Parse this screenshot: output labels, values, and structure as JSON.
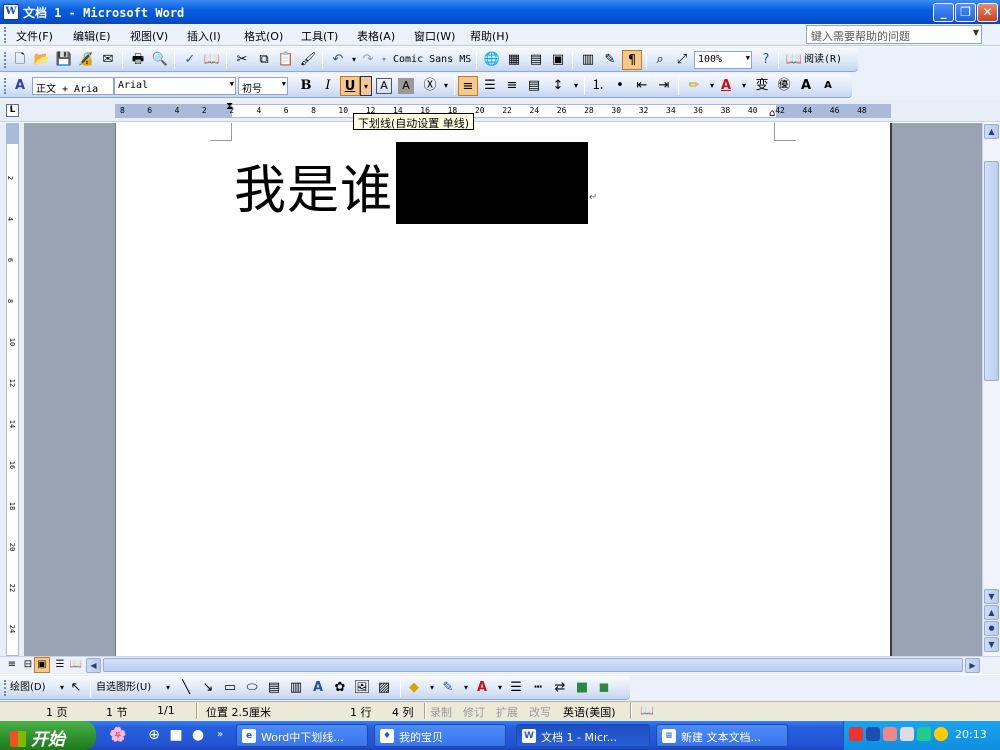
{
  "titlebar": {
    "title": "文档 1 - Microsoft Word",
    "app_icon": "W",
    "minimize_icon": "minimize-icon",
    "maximize_icon": "restore-icon",
    "close_icon": "close-icon"
  },
  "menubar": {
    "items": [
      "文件(F)",
      "编辑(E)",
      "视图(V)",
      "插入(I)",
      "格式(O)",
      "工具(T)",
      "表格(A)",
      "窗口(W)",
      "帮助(H)"
    ],
    "help_placeholder": "键入需要帮助的问题"
  },
  "standard_toolbar": {
    "font_field": "Comic Sans MS",
    "zoom": "100%",
    "read_label": "阅读(R)"
  },
  "formatting_toolbar": {
    "style": "正文 + Aria",
    "font": "Arial",
    "size": "初号",
    "bold": "B",
    "italic": "I",
    "underline": "U",
    "char_border": "A",
    "char_shading": "A"
  },
  "ruler": {
    "labels": [
      "8",
      "6",
      "4",
      "2",
      "2",
      "4",
      "6",
      "8",
      "10",
      "12",
      "14",
      "16",
      "18",
      "20",
      "22",
      "24",
      "26",
      "28",
      "30",
      "32",
      "34",
      "36",
      "38",
      "40",
      "42",
      "44",
      "46",
      "48"
    ]
  },
  "vruler": {
    "labels": [
      "2",
      "4",
      "6",
      "8",
      "10",
      "12",
      "14",
      "16",
      "18",
      "20",
      "22",
      "24"
    ]
  },
  "tooltip": "下划线(自动设置 单线)",
  "document": {
    "text": "我是谁",
    "para_mark": "↵"
  },
  "drawing_toolbar": {
    "draw_label": "绘图(D)",
    "autoshapes_label": "自选图形(U)"
  },
  "statusbar": {
    "page": "1 页",
    "section": "1 节",
    "pages": "1/1",
    "position": "位置 2.5厘米",
    "line": "1 行",
    "column": "4 列",
    "rec": "录制",
    "trk": "修订",
    "ext": "扩展",
    "ovr": "改写",
    "language": "英语(美国)"
  },
  "taskbar": {
    "start": "开始",
    "tasks": [
      "Word中下划线...",
      "我的宝贝",
      "文档 1 - Micr...",
      "新建 文本文档..."
    ],
    "clock": "20:13"
  },
  "colors": {
    "titlebar": "#0a5fe0",
    "workspace": "#9aa3b4",
    "taskbar": "#2454d4",
    "start": "#2c8f2c"
  }
}
